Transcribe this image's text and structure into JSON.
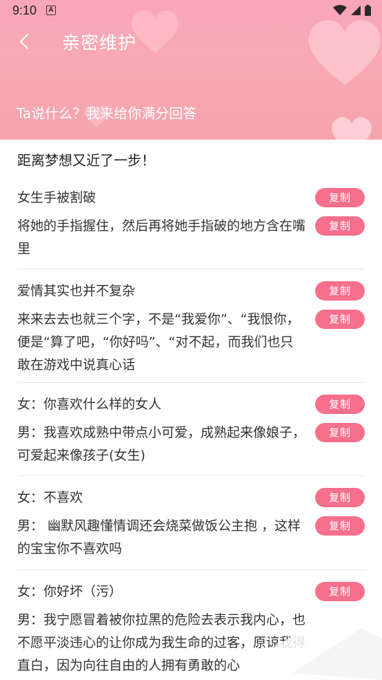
{
  "status_bar": {
    "time": "9:10",
    "notice": "A"
  },
  "nav": {
    "title": "亲密维护"
  },
  "header": {
    "subtitle": "Ta说什么？我来给你满分回答"
  },
  "content": {
    "intro": "距离梦想又近了一步！",
    "copy_label": "复制",
    "groups": [
      {
        "question": "女生手被割破",
        "answer": "将她的手指握住，然后再将她手指破的地方含在嘴里"
      },
      {
        "question": "爱情其实也并不复杂",
        "answer": "来来去去也就三个字，不是“我爱你”、“我恨你，便是“算了吧，“你好吗”、“对不起，而我们也只敢在游戏中说真心话"
      },
      {
        "question": "女：你喜欢什么样的女人",
        "answer": "男：我喜欢成熟中带点小可爱，成熟起来像娘子，可爱起来像孩子(女生)"
      },
      {
        "question": "女：不喜欢",
        "answer": "男： 幽默风趣懂情调还会烧菜做饭公主抱 ，这样的宝宝你不喜欢吗"
      },
      {
        "question": "女：你好坏（污）",
        "answer": "男：我宁愿冒着被你拉黑的危险去表示我内心，也不愿平淡违心的让你成为我生命的过客，原谅我得直白，因为向往自由的人拥有勇敢的心"
      }
    ]
  }
}
